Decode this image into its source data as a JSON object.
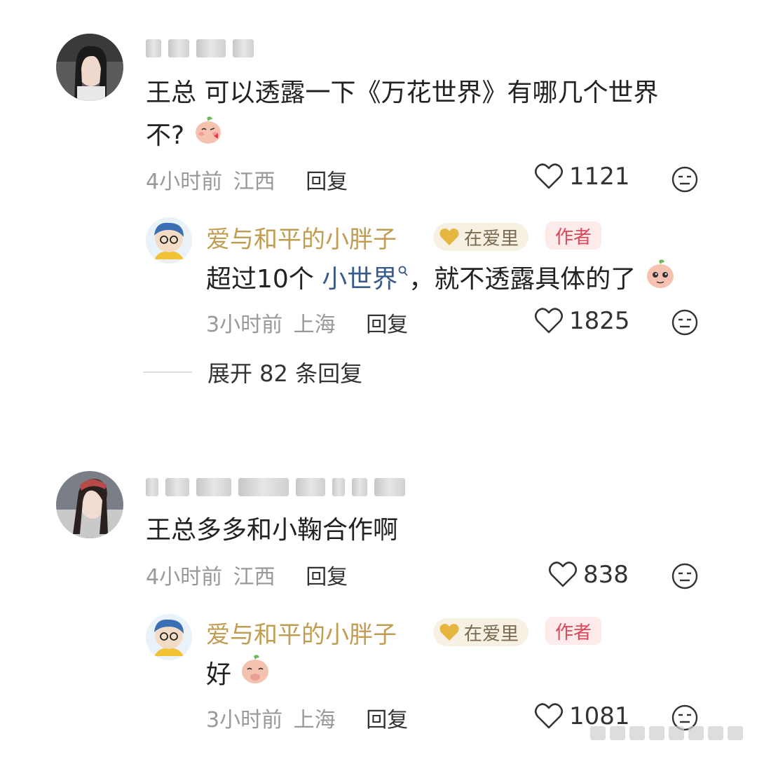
{
  "comments": [
    {
      "text_line1": "王总 可以透露一下《万花世界》有哪几个世界",
      "text_line2": "不?",
      "time": "4小时前",
      "location": "江西",
      "reply_label": "回复",
      "likes": "1121",
      "emoji_icon": "peach-kiss-icon",
      "reply": {
        "author": "爱与和平的小胖子",
        "badge_love": "在爱里",
        "badge_author": "作者",
        "text_prefix": "超过10个 ",
        "text_link": "小世界",
        "text_suffix": "，就不透露具体的了",
        "emoji_icon": "peach-shy-icon",
        "time": "3小时前",
        "location": "上海",
        "reply_label": "回复",
        "likes": "1825"
      },
      "expand_label": "展开 82 条回复"
    },
    {
      "text_line1": "王总多多和小鞠合作啊",
      "time": "4小时前",
      "location": "江西",
      "reply_label": "回复",
      "likes": "838",
      "reply": {
        "author": "爱与和平的小胖子",
        "badge_love": "在爱里",
        "badge_author": "作者",
        "text": "好",
        "emoji_icon": "peach-cover-icon",
        "time": "3小时前",
        "location": "上海",
        "reply_label": "回复",
        "likes": "1081"
      }
    }
  ],
  "colors": {
    "author_name": "#c19d53",
    "badge_author_text": "#e0465a",
    "link_text": "#3a5a8c",
    "meta_text": "#999999"
  }
}
